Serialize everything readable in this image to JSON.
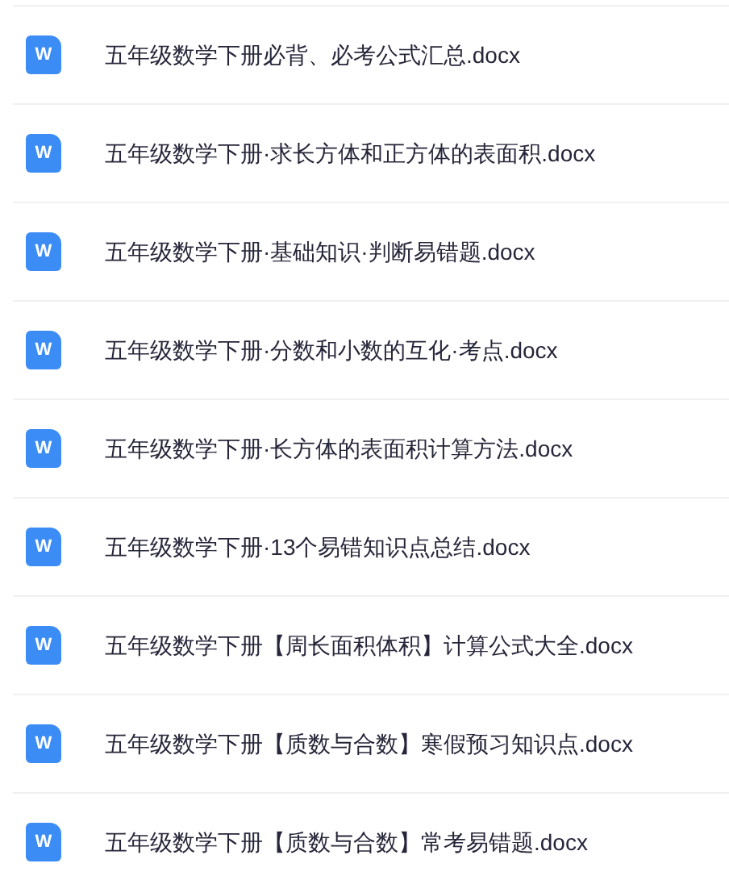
{
  "files": [
    {
      "icon": "W",
      "name": "五年级数学下册必背、必考公式汇总.docx"
    },
    {
      "icon": "W",
      "name": "五年级数学下册·求长方体和正方体的表面积.docx"
    },
    {
      "icon": "W",
      "name": "五年级数学下册·基础知识·判断易错题.docx"
    },
    {
      "icon": "W",
      "name": "五年级数学下册·分数和小数的互化·考点.docx"
    },
    {
      "icon": "W",
      "name": "五年级数学下册·长方体的表面积计算方法.docx"
    },
    {
      "icon": "W",
      "name": "五年级数学下册·13个易错知识点总结.docx"
    },
    {
      "icon": "W",
      "name": "五年级数学下册【周长面积体积】计算公式大全.docx"
    },
    {
      "icon": "W",
      "name": "五年级数学下册【质数与合数】寒假预习知识点.docx"
    },
    {
      "icon": "W",
      "name": "五年级数学下册【质数与合数】常考易错题.docx"
    }
  ]
}
